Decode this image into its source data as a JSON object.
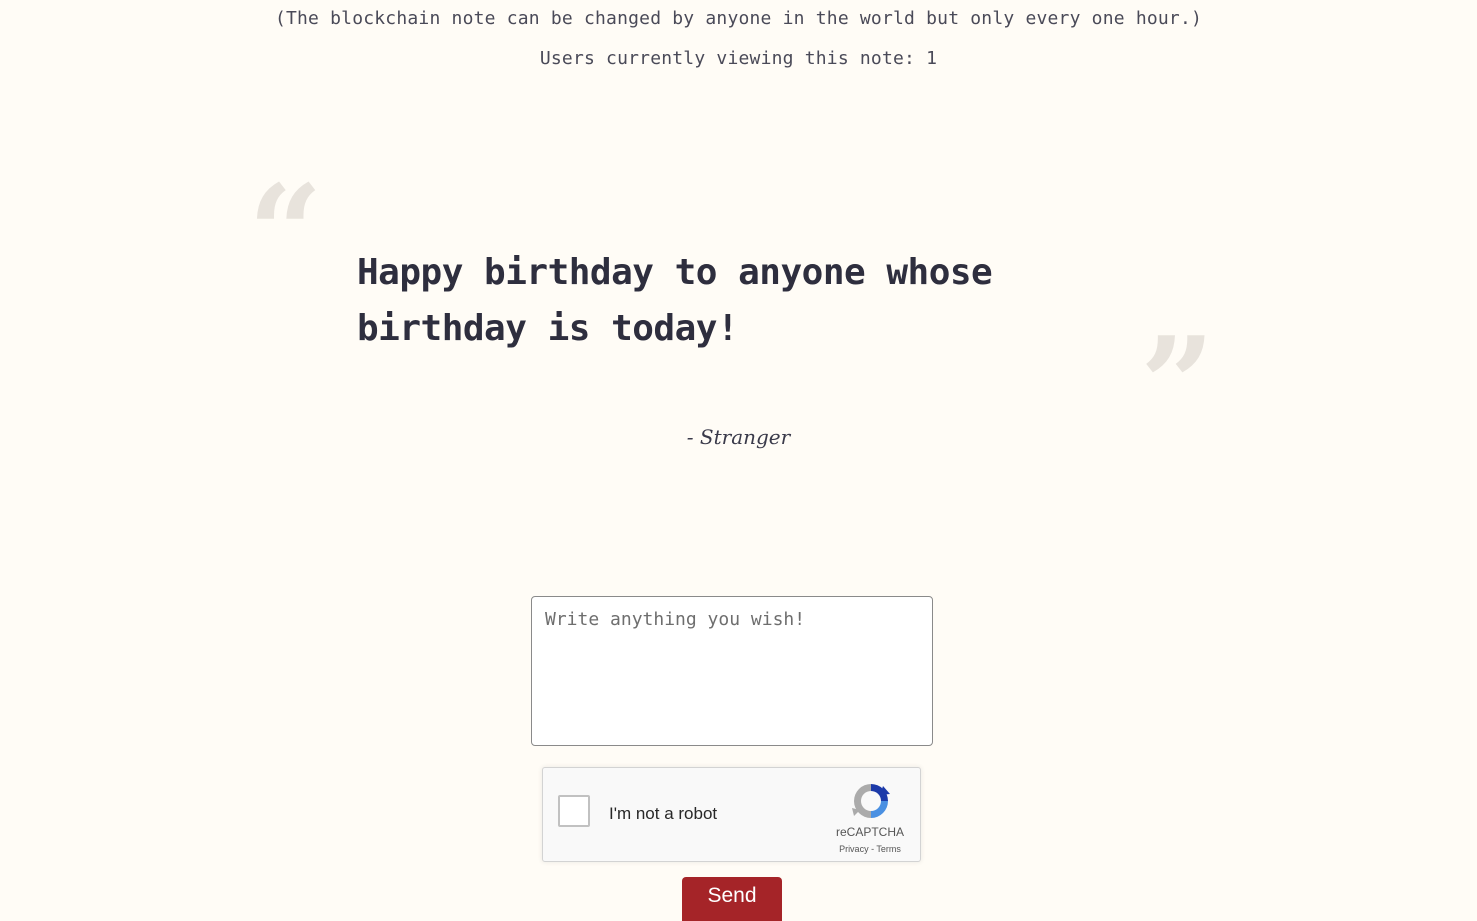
{
  "header": {
    "info_text": "(The blockchain note can be changed by anyone in the world but only every one hour.)",
    "viewers_text": "Users currently viewing this note: 1"
  },
  "note": {
    "open_quote": "“",
    "close_quote": "”",
    "text": "Happy birthday to anyone whose birthday is today!",
    "author": "- Stranger"
  },
  "form": {
    "input_placeholder": "Write anything you wish!",
    "input_value": "",
    "captcha_label": "I'm not a robot",
    "captcha_brand": "reCAPTCHA",
    "captcha_privacy": "Privacy",
    "captcha_separator": " - ",
    "captcha_terms": "Terms",
    "send_label": "Send"
  },
  "icons": {
    "captcha_logo": "recaptcha-icon"
  },
  "colors": {
    "background": "#fffcf6",
    "send_button": "#a52428",
    "quote_marks": "#e8e3dc"
  }
}
